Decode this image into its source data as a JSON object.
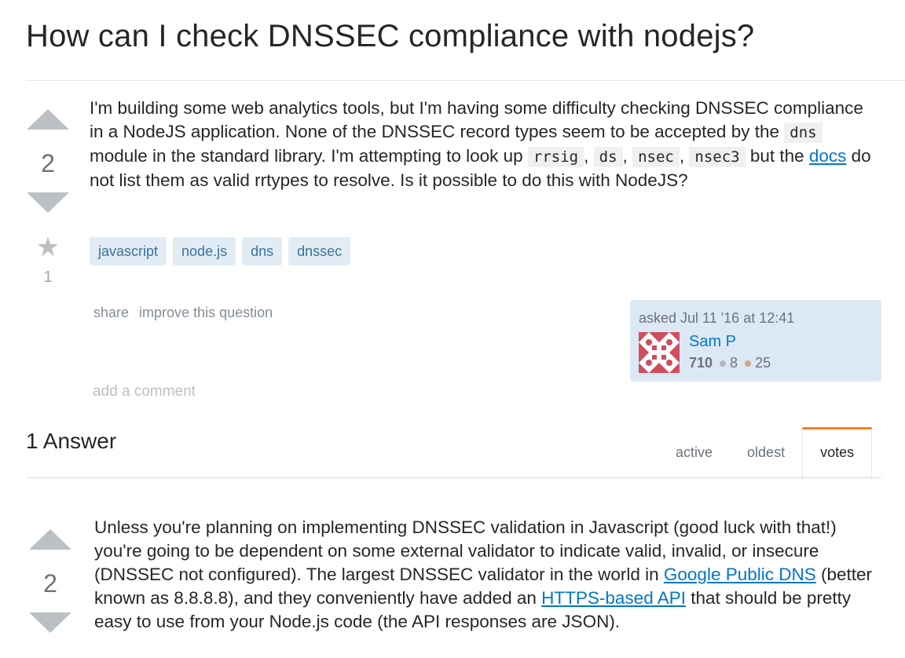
{
  "question": {
    "title": "How can I check DNSSEC compliance with nodejs?",
    "votes": "2",
    "favorites": "1",
    "body": {
      "t1": "I'm building some web analytics tools, but I'm having some difficulty checking DNSSEC compliance in a NodeJS application. None of the DNSSEC record types seem to be accepted by the ",
      "code_dns": "dns",
      "t2": " module in the standard library. I'm attempting to look up ",
      "code_rrsig": "rrsig",
      "code_ds": "ds",
      "code_nsec": "nsec",
      "code_nsec3": "nsec3",
      "comma": ",",
      "t3": " but the ",
      "docs_link": "docs",
      "t4": " do not list them as valid rrtypes to resolve. Is it possible to do this with NodeJS?"
    },
    "tags": [
      "javascript",
      "node.js",
      "dns",
      "dnssec"
    ],
    "menu": {
      "share": "share",
      "improve": "improve this question"
    },
    "owner": {
      "asked": "asked Jul 11 '16 at 12:41",
      "name": "Sam P",
      "reputation": "710",
      "silver": "8",
      "bronze": "25",
      "silver_color": "#b4b8bc",
      "bronze_color": "#d1a684"
    },
    "add_comment": "add a comment"
  },
  "answers": {
    "header": "1 Answer",
    "tabs": [
      "active",
      "oldest",
      "votes"
    ],
    "selected_tab": "votes",
    "accent_color": "#f48024",
    "answer": {
      "votes": "2",
      "t1": "Unless you're planning on implementing DNSSEC validation in Javascript (good luck with that!) you're going to be dependent on some external validator to indicate valid, invalid, or insecure (DNSSEC not configured). The largest DNSSEC validator in the world in ",
      "link1": "Google Public DNS",
      "t2": " (better known as 8.8.8.8), and they conveniently have added an ",
      "link2": "HTTPS-based API",
      "t3": " that should be pretty easy to use from your Node.js code (the API responses are JSON)."
    }
  },
  "icons": {
    "upvote": "upvote-arrow-icon",
    "downvote": "downvote-arrow-icon",
    "favorite": "star-icon",
    "avatar": "identicon-avatar"
  }
}
